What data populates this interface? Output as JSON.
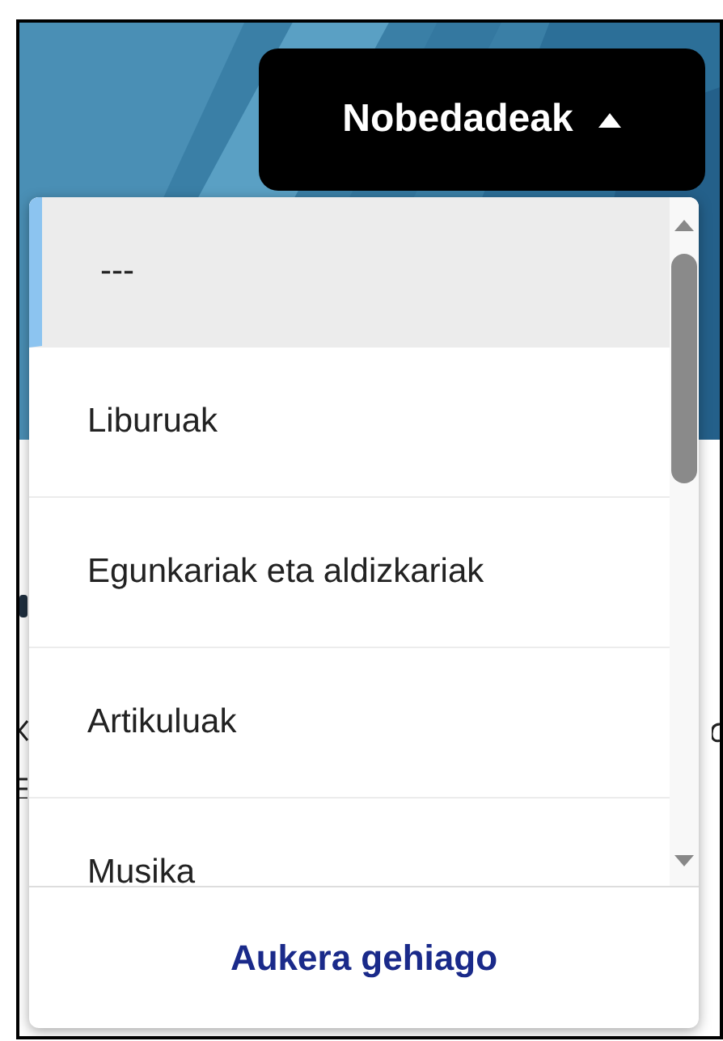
{
  "menu_button": {
    "label": "Nobedadeak",
    "expanded": true
  },
  "dropdown": {
    "options": [
      {
        "label": "---",
        "selected": true
      },
      {
        "label": "Liburuak",
        "selected": false
      },
      {
        "label": "Egunkariak eta aldizkariak",
        "selected": false
      },
      {
        "label": "Artikuluak",
        "selected": false
      },
      {
        "label": "Musika",
        "selected": false
      }
    ],
    "more_link": "Aukera gehiago"
  }
}
